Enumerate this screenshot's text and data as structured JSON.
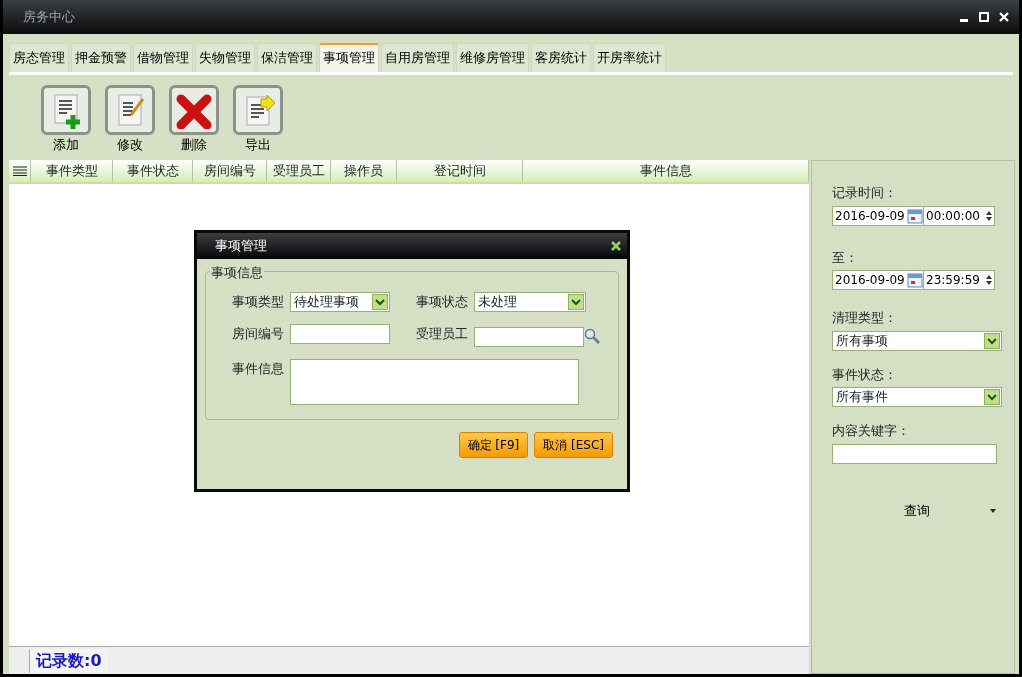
{
  "window": {
    "title": "房务中心"
  },
  "tabs": [
    {
      "label": "房态管理",
      "selected": false
    },
    {
      "label": "押金预警",
      "selected": false
    },
    {
      "label": "借物管理",
      "selected": false
    },
    {
      "label": "失物管理",
      "selected": false
    },
    {
      "label": "保洁管理",
      "selected": false
    },
    {
      "label": "事项管理",
      "selected": true
    },
    {
      "label": "自用房管理",
      "selected": false
    },
    {
      "label": "维修房管理",
      "selected": false
    },
    {
      "label": "客房统计",
      "selected": false
    },
    {
      "label": "开房率统计",
      "selected": false
    }
  ],
  "toolbar": [
    {
      "label": "添加",
      "kind": "add"
    },
    {
      "label": "修改",
      "kind": "edit"
    },
    {
      "label": "删除",
      "kind": "delete"
    },
    {
      "label": "导出",
      "kind": "export"
    }
  ],
  "table": {
    "columns": [
      "事件类型",
      "事件状态",
      "房间编号",
      "受理员工",
      "操作员",
      "登记时间",
      "事件信息"
    ]
  },
  "status_bar": {
    "record_count": "记录数:0"
  },
  "filter": {
    "from_label": "记录时间：",
    "from_date": "2016-09-09",
    "from_time": "00:00:00",
    "to_label": "至：",
    "to_date": "2016-09-09",
    "to_time": "23:59:59",
    "type_label": "清理类型：",
    "type_value": "所有事项",
    "status_label": "事件状态：",
    "status_value": "所有事件",
    "keyword_label": "内容关键字：",
    "query_button": "查询"
  },
  "dialog": {
    "title": "事项管理",
    "group_title": "事项信息",
    "fields": [
      {
        "kind": "select",
        "label": "事项类型",
        "value": "待处理事项"
      },
      {
        "kind": "select",
        "label": "事项状态",
        "value": "未处理"
      },
      {
        "kind": "text",
        "label": "房间编号"
      },
      {
        "kind": "search",
        "label": "受理员工"
      },
      {
        "kind": "textarea",
        "label": "事件信息"
      }
    ],
    "buttons": [
      "确定 [F9]",
      "取消 [ESC]"
    ]
  }
}
